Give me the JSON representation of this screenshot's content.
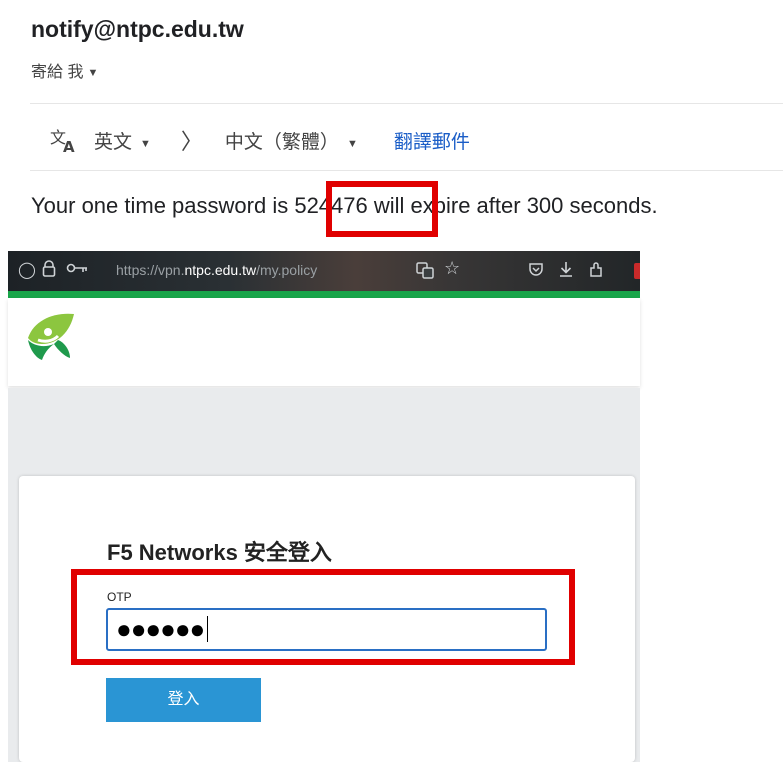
{
  "email": {
    "sender": "notify@ntpc.edu.tw",
    "recipient": "寄給 我",
    "translate": {
      "from_lang": "英文",
      "to_lang": "中文（繁體）",
      "translate_link": "翻譯郵件"
    },
    "body": {
      "before": "Your one time password is ",
      "code": "524476",
      "after": " will expire after 300 seconds."
    }
  },
  "browser": {
    "url_prefix": "https://vpn.",
    "url_domain": "ntpc.edu.tw",
    "url_suffix": "/my.policy"
  },
  "login": {
    "title": "F5 Networks 安全登入",
    "otp_label": "OTP",
    "otp_masked": "●●●●●●",
    "button_label": "登入"
  },
  "colors": {
    "highlight": "#e00000",
    "accent_green": "#19a54a",
    "button_blue": "#2a95d4",
    "link_blue": "#1a5dc7"
  }
}
